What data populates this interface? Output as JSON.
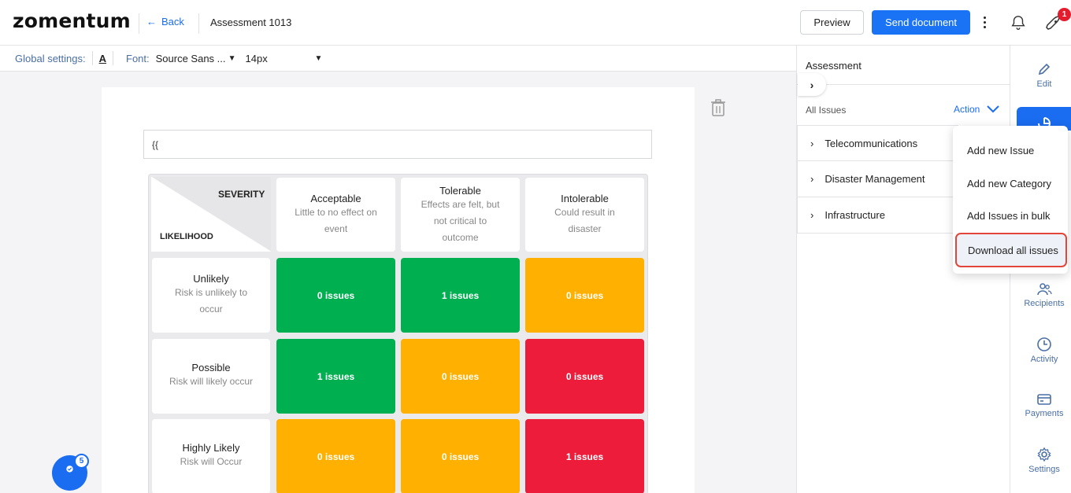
{
  "header": {
    "logo": "zomentum",
    "back_label": "Back",
    "doc_title": "Assessment 1013",
    "preview_label": "Preview",
    "send_label": "Send document",
    "notification_count": "1"
  },
  "settings_bar": {
    "global_label": "Global settings:",
    "font_label": "Font:",
    "font_value": "Source Sans ...",
    "size_value": "14px"
  },
  "editor": {
    "input_value": "{{"
  },
  "matrix": {
    "severity_label": "SEVERITY",
    "likelihood_label": "LIKELIHOOD",
    "columns": [
      {
        "title": "Acceptable",
        "desc": "Little to no effect on event"
      },
      {
        "title": "Tolerable",
        "desc": "Effects are felt, but not critical to outcome"
      },
      {
        "title": "Intolerable",
        "desc": "Could result in disaster"
      }
    ],
    "rows": [
      {
        "title": "Unlikely",
        "desc": "Risk is unlikely to occur"
      },
      {
        "title": "Possible",
        "desc": "Risk will likely occur"
      },
      {
        "title": "Highly Likely",
        "desc": "Risk will Occur"
      }
    ],
    "cells": [
      [
        "0 issues",
        "1 issues",
        "0 issues"
      ],
      [
        "1 issues",
        "0 issues",
        "0 issues"
      ],
      [
        "0 issues",
        "0 issues",
        "1 issues"
      ]
    ],
    "colors": {
      "green": "#00b050",
      "amber": "#ffb000",
      "red": "#ec1c3a"
    }
  },
  "chat": {
    "badge": "5"
  },
  "panel": {
    "title": "Assessment",
    "all_issues": "All Issues",
    "action_label": "Action",
    "categories": [
      "Telecommunications",
      "Disaster Management",
      "Infrastructure"
    ]
  },
  "action_menu": {
    "items": [
      "Add new Issue",
      "Add new Category",
      "Add Issues in bulk",
      "Download all issues"
    ]
  },
  "right_nav": {
    "edit": "Edit",
    "recipients": "Recipients",
    "activity": "Activity",
    "payments": "Payments",
    "settings": "Settings"
  }
}
